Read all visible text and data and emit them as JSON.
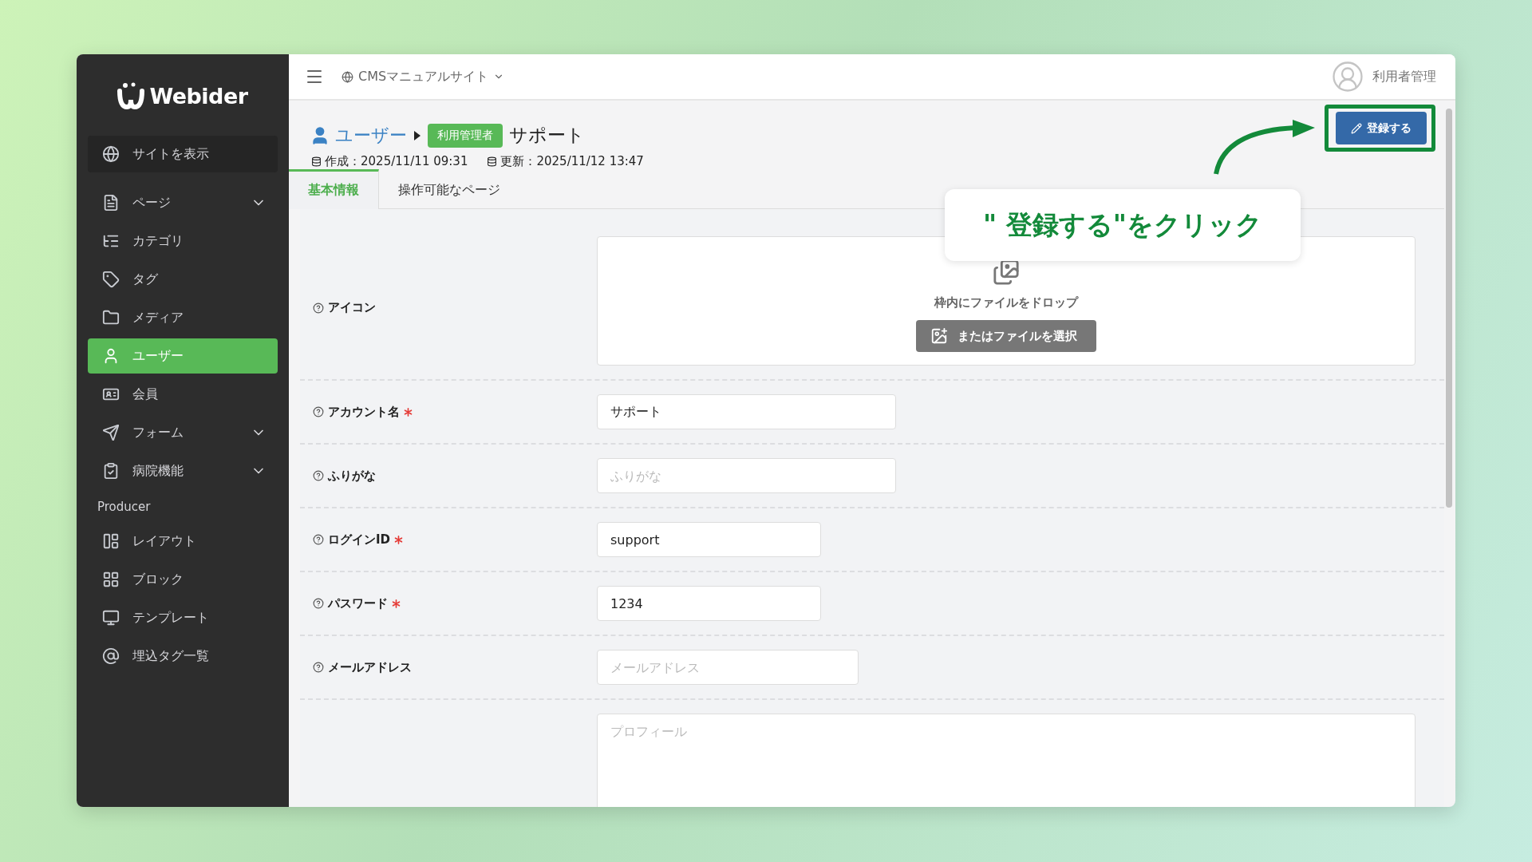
{
  "sidebar": {
    "logo": "Webider",
    "view_site": "サイトを表示",
    "items": [
      {
        "label": "ページ",
        "expandable": true,
        "selected": false
      },
      {
        "label": "カテゴリ",
        "expandable": false,
        "selected": false
      },
      {
        "label": "タグ",
        "expandable": false,
        "selected": false
      },
      {
        "label": "メディア",
        "expandable": false,
        "selected": false
      },
      {
        "label": "ユーザー",
        "expandable": false,
        "selected": true
      },
      {
        "label": "会員",
        "expandable": false,
        "selected": false
      },
      {
        "label": "フォーム",
        "expandable": true,
        "selected": false
      },
      {
        "label": "病院機能",
        "expandable": true,
        "selected": false
      }
    ],
    "section_label": "Producer",
    "producer_items": [
      {
        "label": "レイアウト",
        "selected": false
      },
      {
        "label": "ブロック",
        "selected": false
      },
      {
        "label": "テンプレート",
        "selected": false
      },
      {
        "label": "埋込タグ一覧",
        "selected": false
      }
    ]
  },
  "header": {
    "site": "CMSマニュアルサイト",
    "user": "利用者管理"
  },
  "page": {
    "breadcrumb": "ユーザー",
    "role_badge": "利用管理者",
    "title": "サポート",
    "created": "作成：2025/11/11 09:31",
    "updated": "更新：2025/11/12 13:47",
    "save_button": "登録する"
  },
  "tabs": [
    {
      "label": "基本情報",
      "selected": true
    },
    {
      "label": "操作可能なページ",
      "selected": false
    }
  ],
  "form": {
    "icon_field": {
      "label": "アイコン",
      "drop_text": "枠内にファイルをドロップ",
      "select_button": "またはファイルを選択"
    },
    "fields": [
      {
        "kind": "text",
        "label": "アカウント名",
        "required": true,
        "value": "サポート"
      },
      {
        "kind": "text",
        "label": "ふりがな",
        "required": false,
        "placeholder": "ふりがな"
      },
      {
        "kind": "text",
        "label": "ログインID",
        "required": true,
        "value": "support"
      },
      {
        "kind": "text",
        "label": "パスワード",
        "required": true,
        "value": "1234"
      },
      {
        "kind": "text",
        "label": "メールアドレス",
        "required": false,
        "placeholder": "メールアドレス"
      },
      {
        "kind": "textarea",
        "placeholder": "プロフィール"
      }
    ]
  },
  "annotation": {
    "callout": "\" 登録する\"をクリック"
  }
}
